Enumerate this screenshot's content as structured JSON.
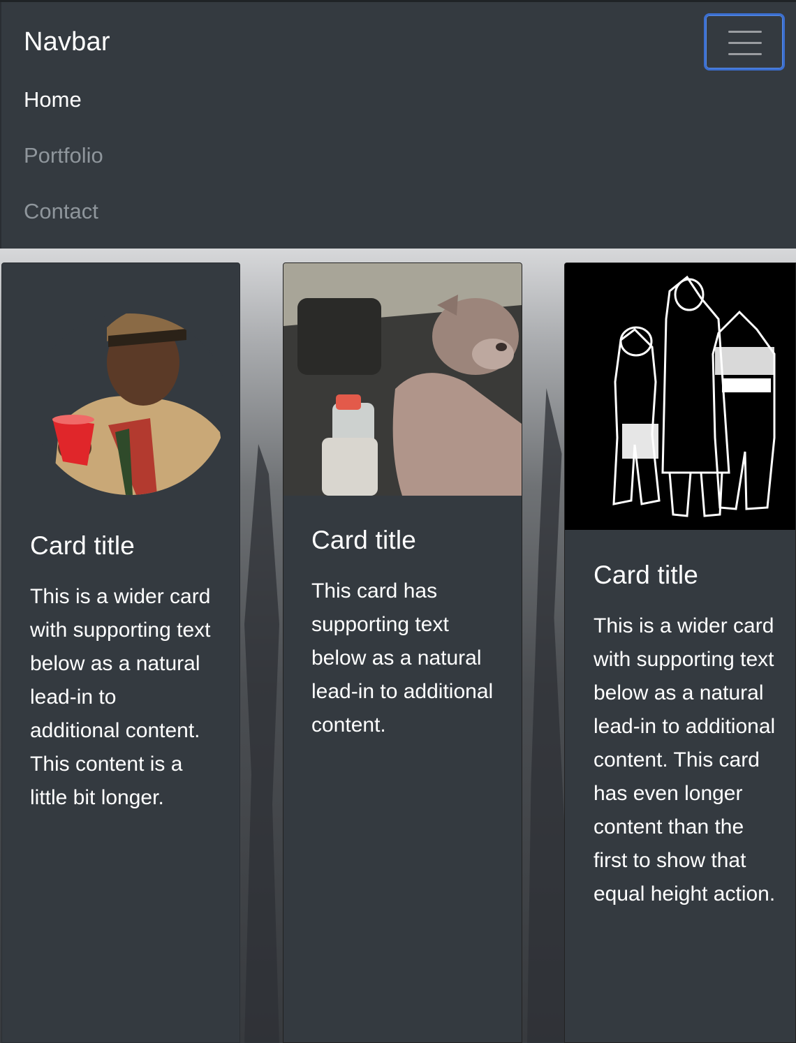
{
  "navbar": {
    "brand": "Navbar",
    "items": [
      {
        "label": "Home",
        "active": true
      },
      {
        "label": "Portfolio",
        "active": false
      },
      {
        "label": "Contact",
        "active": false
      }
    ],
    "toggler_icon": "hamburger-icon"
  },
  "cards": [
    {
      "title": "Card title",
      "text": "This is a wider card with supporting text below as a natural lead-in to additional content. This content is a little bit longer.",
      "image": "man-with-red-cup-photo"
    },
    {
      "title": "Card title",
      "text": "This card has supporting text below as a natural lead-in to additional content.",
      "image": "dog-in-car-photo"
    },
    {
      "title": "Card title",
      "text": "This is a wider card with supporting text below as a natural lead-in to additional content. This card has even longer content than the first to show that equal height action.",
      "image": "manga-characters-illustration"
    }
  ],
  "colors": {
    "navbar_bg": "#343a40",
    "card_bg": "#343a40",
    "muted_link": "#8f969c",
    "toggler_focus": "#3b6fd1"
  }
}
